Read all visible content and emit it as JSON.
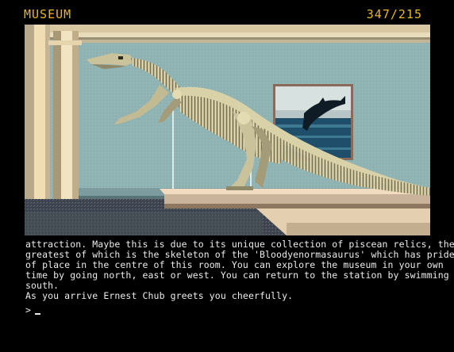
{
  "status_bar": {
    "location": "MUSEUM",
    "score": "347/215"
  },
  "scene": {
    "subject": "dinosaur-skeleton-exhibit",
    "painting": "dolphin-painting",
    "colors": {
      "wall": "#8fb2b3",
      "column": "#f0ddb4",
      "floor": "#3f4652",
      "bone": "#c9c29a",
      "accent": "#e8b81e"
    }
  },
  "narration": {
    "lines": [
      "attraction. Maybe this is due to its unique collection of piscean relics, the",
      "greatest of which is the skeleton of the 'Bloodyenormasaurus' which has pride",
      "of place in the centre of this room. You can explore the museum in your own",
      "time by going north, east or west. You can return to the station by swimming",
      "south.",
      "As you arrive Ernest Chub greets you cheerfully."
    ]
  },
  "prompt": {
    "symbol": ">",
    "value": ""
  }
}
